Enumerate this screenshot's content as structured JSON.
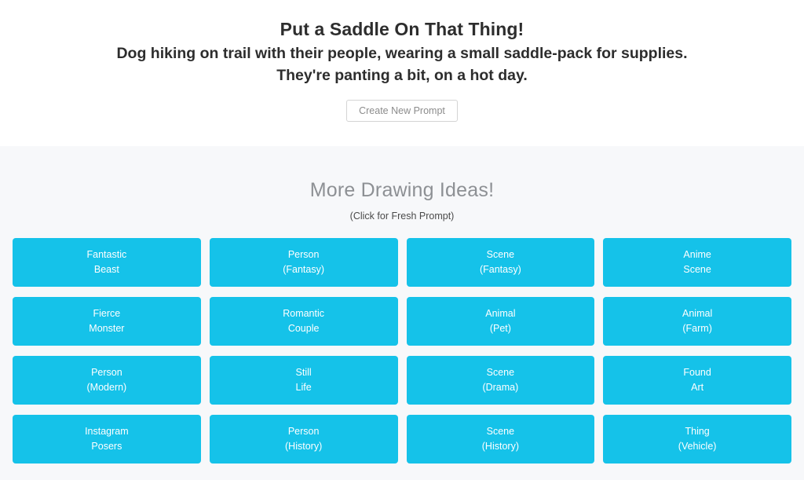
{
  "hero": {
    "prompt_title": "Put a Saddle On That Thing!",
    "prompt_line_1": "Dog hiking on trail with their people, wearing a small saddle-pack for supplies.",
    "prompt_line_2": "They're panting a bit, on a hot day.",
    "new_prompt_label": "Create New Prompt"
  },
  "ideas": {
    "title": "More Drawing Ideas!",
    "subtitle": "(Click for Fresh Prompt)",
    "tiles": [
      {
        "line1": "Fantastic",
        "line2": "Beast"
      },
      {
        "line1": "Person",
        "line2": "(Fantasy)"
      },
      {
        "line1": "Scene",
        "line2": "(Fantasy)"
      },
      {
        "line1": "Anime",
        "line2": "Scene"
      },
      {
        "line1": "Fierce",
        "line2": "Monster"
      },
      {
        "line1": "Romantic",
        "line2": "Couple"
      },
      {
        "line1": "Animal",
        "line2": "(Pet)"
      },
      {
        "line1": "Animal",
        "line2": "(Farm)"
      },
      {
        "line1": "Person",
        "line2": "(Modern)"
      },
      {
        "line1": "Still",
        "line2": "Life"
      },
      {
        "line1": "Scene",
        "line2": "(Drama)"
      },
      {
        "line1": "Found",
        "line2": "Art"
      },
      {
        "line1": "Instagram",
        "line2": "Posers"
      },
      {
        "line1": "Person",
        "line2": "(History)"
      },
      {
        "line1": "Scene",
        "line2": "(History)"
      },
      {
        "line1": "Thing",
        "line2": "(Vehicle)"
      }
    ]
  },
  "colors": {
    "tile_blue": "#15c2e9",
    "section_bg": "#f7f8fa",
    "page_bg": "#ffffff",
    "heading_gray": "#8d9094",
    "text_dark": "#2d2d2d",
    "button_border": "#d4d4d4",
    "button_text": "#8c8c8c"
  }
}
